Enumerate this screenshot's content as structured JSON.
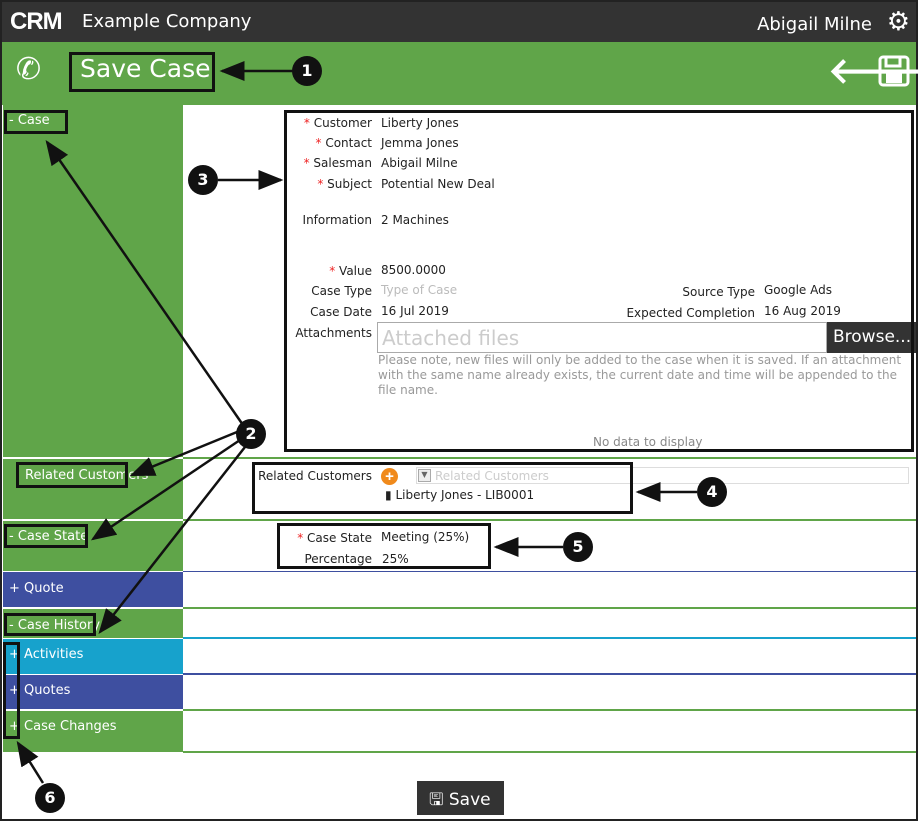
{
  "header": {
    "logo": "CRM",
    "company": "Example Company",
    "user": "Abigail Milne",
    "settings_icon": "gear-icon"
  },
  "toolbar": {
    "title": "Save Case",
    "phone_icon": "phone-icon",
    "back_icon": "arrow-left-icon",
    "save_icon": "floppy-disk-icon"
  },
  "sidebar": {
    "sections": [
      {
        "label": "Case",
        "toggle": "-",
        "color": "#60a549"
      },
      {
        "label": "Related Customers",
        "toggle": "",
        "color": "#60a549"
      },
      {
        "label": "Case State",
        "toggle": "-",
        "color": "#60a549"
      },
      {
        "label": "Quote",
        "toggle": "+",
        "color": "#3e4fa0"
      },
      {
        "label": "Case History",
        "toggle": "-",
        "color": "#60a549"
      },
      {
        "label": "Activities",
        "toggle": "+",
        "color": "#17a2cc"
      },
      {
        "label": "Quotes",
        "toggle": "+",
        "color": "#3e4fa0"
      },
      {
        "label": "Case Changes",
        "toggle": "+",
        "color": "#60a549"
      }
    ]
  },
  "case": {
    "customer_label": "Customer",
    "customer": "Liberty Jones",
    "contact_label": "Contact",
    "contact": "Jemma Jones",
    "salesman_label": "Salesman",
    "salesman": "Abigail Milne",
    "subject_label": "Subject",
    "subject": "Potential New Deal",
    "information_label": "Information",
    "information": "2 Machines",
    "value_label": "Value",
    "value": "8500.0000",
    "case_type_label": "Case Type",
    "case_type_placeholder": "Type of Case",
    "case_date_label": "Case Date",
    "case_date": "16 Jul 2019",
    "source_type_label": "Source Type",
    "source_type": "Google Ads",
    "expected_completion_label": "Expected Completion",
    "expected_completion": "16 Aug 2019",
    "attachments_label": "Attachments",
    "attachments_placeholder": "Attached files",
    "browse": "Browse...",
    "note": "Please note, new files will only be added to the case when it is saved. If an attachment with the same name already exists, the current date and time will be appended to the file name.",
    "no_data": "No data to display",
    "required_mark": "*"
  },
  "related": {
    "label": "Related Customers",
    "placeholder": "Related Customers",
    "item": "Liberty Jones - LIB0001"
  },
  "case_state": {
    "state_label": "Case State",
    "state": "Meeting (25%)",
    "percentage_label": "Percentage",
    "percentage": "25%"
  },
  "footer": {
    "save": "Save"
  },
  "annotations": [
    "1",
    "2",
    "3",
    "4",
    "5",
    "6"
  ]
}
